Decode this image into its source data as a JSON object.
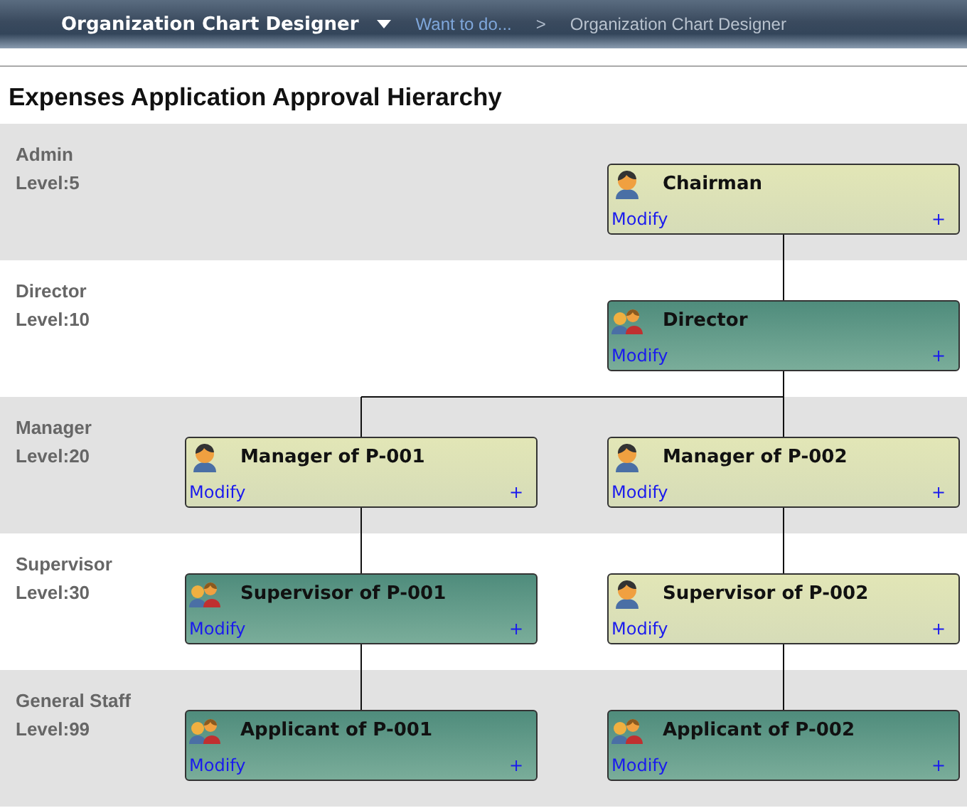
{
  "header": {
    "app_title": "Organization Chart Designer",
    "menu_link": "Want to do...",
    "separator": ">",
    "breadcrumb": "Organization Chart Designer"
  },
  "page_title": "Expenses Application Approval Hierarchy",
  "levels": [
    {
      "name": "Admin",
      "level": "Level:5"
    },
    {
      "name": "Director",
      "level": "Level:10"
    },
    {
      "name": "Manager",
      "level": "Level:20"
    },
    {
      "name": "Supervisor",
      "level": "Level:30"
    },
    {
      "name": "General Staff",
      "level": "Level:99"
    }
  ],
  "tree": {
    "title": "Chairman",
    "kind": "person",
    "action": "Modify",
    "add": "+",
    "children": [
      {
        "title": "Director",
        "kind": "group",
        "action": "Modify",
        "add": "+",
        "children": [
          {
            "title": "Manager of P-001",
            "kind": "person",
            "action": "Modify",
            "add": "+",
            "children": [
              {
                "title": "Supervisor of P-001",
                "kind": "group",
                "action": "Modify",
                "add": "+",
                "children": [
                  {
                    "title": "Applicant of P-001",
                    "kind": "group",
                    "action": "Modify",
                    "add": "+"
                  }
                ]
              }
            ]
          },
          {
            "title": "Manager of P-002",
            "kind": "person",
            "action": "Modify",
            "add": "+",
            "children": [
              {
                "title": "Supervisor of P-002",
                "kind": "person",
                "action": "Modify",
                "add": "+",
                "children": [
                  {
                    "title": "Applicant of P-002",
                    "kind": "group",
                    "action": "Modify",
                    "add": "+"
                  }
                ]
              }
            ]
          }
        ]
      }
    ]
  }
}
